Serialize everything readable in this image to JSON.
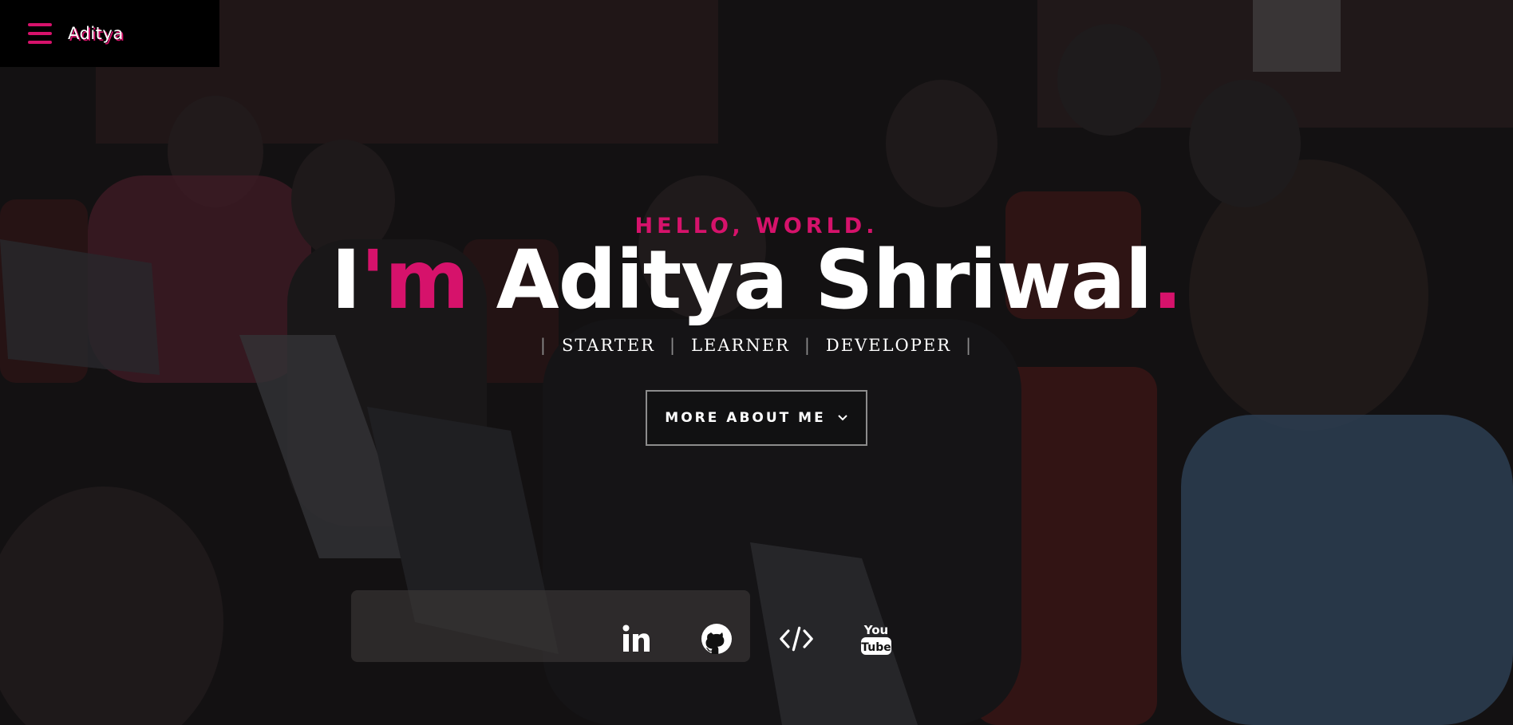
{
  "nav": {
    "brand": "Aditya",
    "menu_icon": "hamburger-menu-icon"
  },
  "hero": {
    "greeting": "HELLO, WORLD.",
    "headline_prefix": "I",
    "headline_apostrophe_m": "'m",
    "headline_name": "Aditya Shriwal",
    "headline_period": ".",
    "roles": [
      "STARTER",
      "LEARNER",
      "DEVELOPER"
    ],
    "separator": "|",
    "cta_label": "MORE ABOUT ME",
    "cta_icon": "chevron-down-icon"
  },
  "social": [
    {
      "name": "linkedin",
      "icon": "linkedin-icon",
      "label": "in"
    },
    {
      "name": "github",
      "icon": "github-icon"
    },
    {
      "name": "code",
      "icon": "code-icon",
      "label": "</>"
    },
    {
      "name": "youtube",
      "icon": "youtube-icon",
      "label_top": "You",
      "label_bottom": "Tube"
    }
  ],
  "colors": {
    "accent": "#d6126b",
    "text": "#ffffff",
    "nav_bg": "#000000",
    "button_border": "#8c8c8c"
  }
}
